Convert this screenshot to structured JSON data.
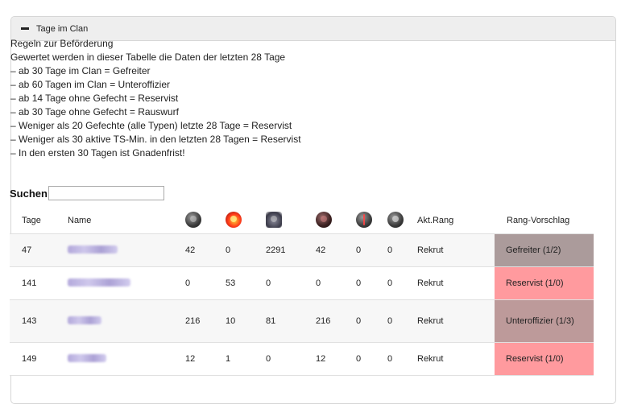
{
  "panel": {
    "title": "Tage im Clan"
  },
  "rules": [
    "Regeln zur Beförderung",
    "Gewertet werden in dieser Tabelle die Daten der letzten 28 Tage",
    "– ab 30 Tage im Clan = Gefreiter",
    "– ab 60 Tagen im Clan = Unteroffizier",
    "– ab 14 Tage ohne Gefecht = Reservist",
    "– ab 30 Tage ohne Gefecht = Rauswurf",
    "– Weniger als 20 Gefechte (alle Typen) letzte 28 Tage = Reservist",
    "– Weniger als 30 aktive TS-Min. in den letzten 28 Tagen = Reservist",
    "– In den ersten 30 Tagen ist Gnadenfrist!"
  ],
  "search": {
    "label": "Suchen",
    "value": ""
  },
  "table": {
    "headers": {
      "tage": "Tage",
      "name": "Name",
      "rang": "Akt.Rang",
      "vorschlag": "Rang-Vorschlag"
    },
    "icons": [
      "medal-icon",
      "fire-icon",
      "tank-icon",
      "battle-icon",
      "dagger-icon",
      "skull-icon"
    ],
    "rows": [
      {
        "tage": "47",
        "s1": "42",
        "s2": "0",
        "s3": "2291",
        "s4": "42",
        "s5": "0",
        "s6": "0",
        "rang": "Rekrut",
        "vorschlag": "Gefreiter (1/2)",
        "vorschlag_color": "#ab9b9b"
      },
      {
        "tage": "141",
        "s1": "0",
        "s2": "53",
        "s3": "0",
        "s4": "0",
        "s5": "0",
        "s6": "0",
        "rang": "Rekrut",
        "vorschlag": "Reservist (1/0)",
        "vorschlag_color": "#ff9a9e"
      },
      {
        "tage": "143",
        "s1": "216",
        "s2": "10",
        "s3": "81",
        "s4": "216",
        "s5": "0",
        "s6": "0",
        "rang": "Rekrut",
        "vorschlag": "Unteroffizier (1/3)",
        "vorschlag_color": "#bd9a9a"
      },
      {
        "tage": "149",
        "s1": "12",
        "s2": "1",
        "s3": "0",
        "s4": "12",
        "s5": "0",
        "s6": "0",
        "rang": "Rekrut",
        "vorschlag": "Reservist (1/0)",
        "vorschlag_color": "#ff9a9e"
      }
    ]
  }
}
